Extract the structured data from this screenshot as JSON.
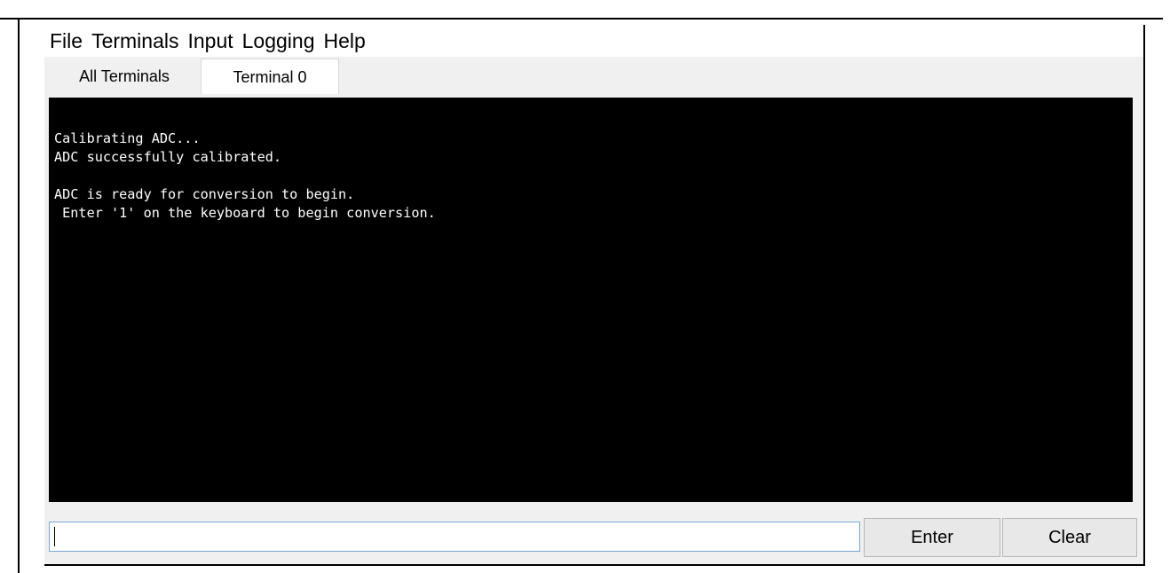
{
  "menubar": {
    "items": [
      "File",
      "Terminals",
      "Input",
      "Logging",
      "Help"
    ]
  },
  "tabs": [
    {
      "label": "All Terminals",
      "active": false
    },
    {
      "label": "Terminal 0",
      "active": true
    }
  ],
  "console": {
    "lines": [
      "Calibrating ADC...",
      "ADC successfully calibrated.",
      "",
      "ADC is ready for conversion to begin.",
      " Enter '1' on the keyboard to begin conversion."
    ]
  },
  "input": {
    "value": "",
    "placeholder": ""
  },
  "buttons": {
    "enter_label": "Enter",
    "clear_label": "Clear"
  },
  "colors": {
    "console_bg": "#000000",
    "console_fg": "#ffffff",
    "input_border": "#7aa7d6"
  }
}
